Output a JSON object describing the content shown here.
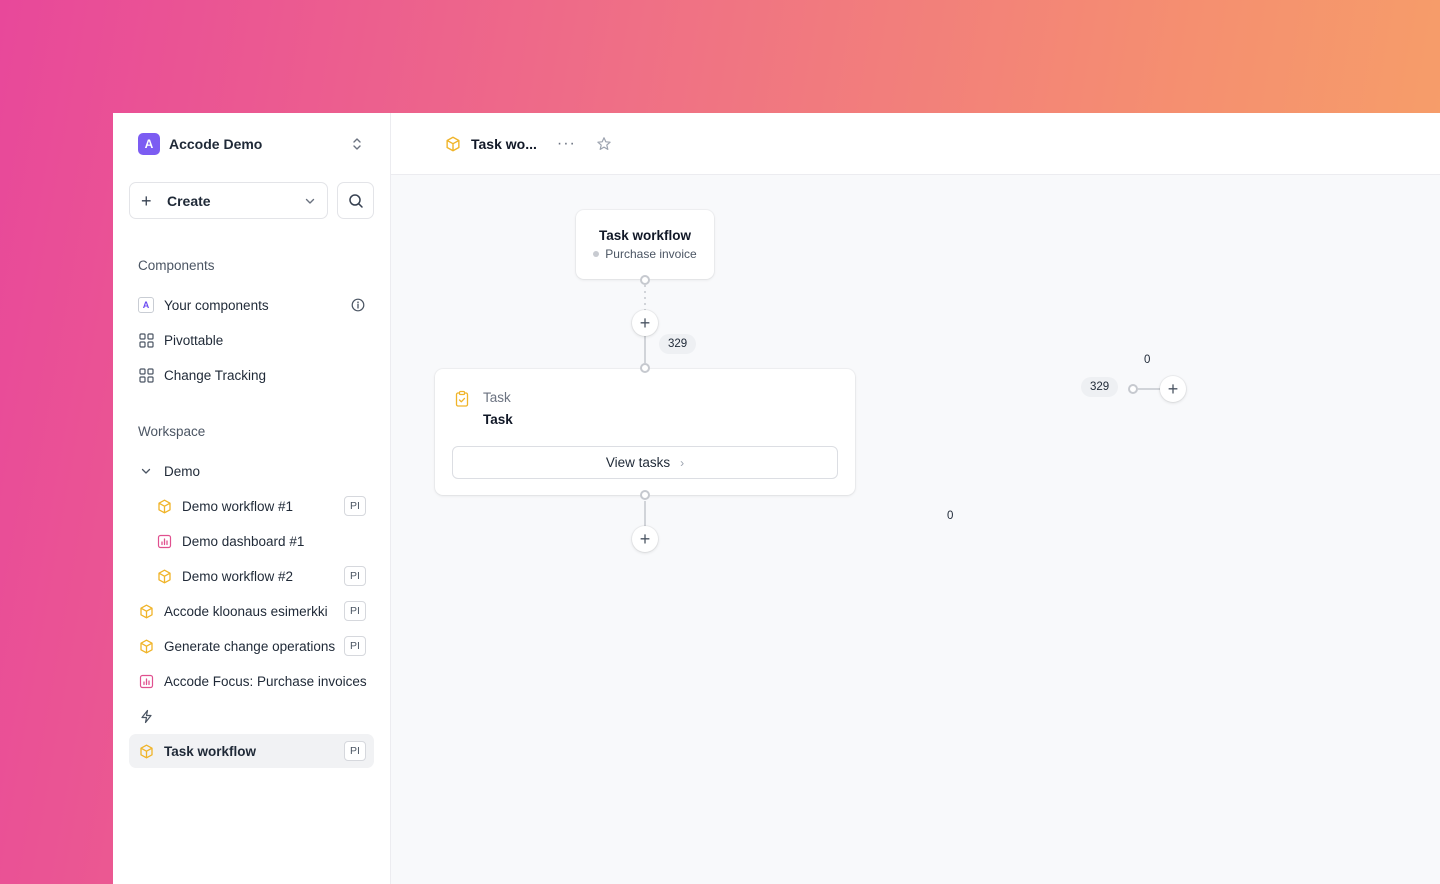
{
  "org": {
    "avatar_letter": "A",
    "name": "Accode Demo"
  },
  "toolbar": {
    "create_label": "Create"
  },
  "components": {
    "title": "Components",
    "items": [
      {
        "label": "Your components",
        "icon_letter": "A"
      },
      {
        "label": "Pivottable"
      },
      {
        "label": "Change Tracking"
      }
    ]
  },
  "workspace": {
    "title": "Workspace",
    "folder": "Demo",
    "items": [
      {
        "label": "Demo workflow #1",
        "badge": "PI"
      },
      {
        "label": "Demo dashboard #1"
      },
      {
        "label": "Demo workflow #2",
        "badge": "PI"
      },
      {
        "label": "Accode kloonaus esimerkki",
        "badge": "PI"
      },
      {
        "label": "Generate change operations",
        "badge": "PI"
      },
      {
        "label": "Accode Focus: Purchase invoices"
      },
      {
        "label": "Task workflow",
        "badge": "PI"
      }
    ]
  },
  "header": {
    "title": "Task wo..."
  },
  "canvas": {
    "start_node": {
      "title": "Task workflow",
      "subtitle": "Purchase invoice"
    },
    "task_node": {
      "kind": "Task",
      "name": "Task",
      "button_label": "View tasks"
    },
    "counts": {
      "in": "329",
      "right_in": "329",
      "right_out": "0",
      "bottom": "0"
    }
  },
  "colors": {
    "accent": "#7c5cf2",
    "workflow_icon": "#f0b429",
    "dashboard_icon": "#e0508f"
  }
}
